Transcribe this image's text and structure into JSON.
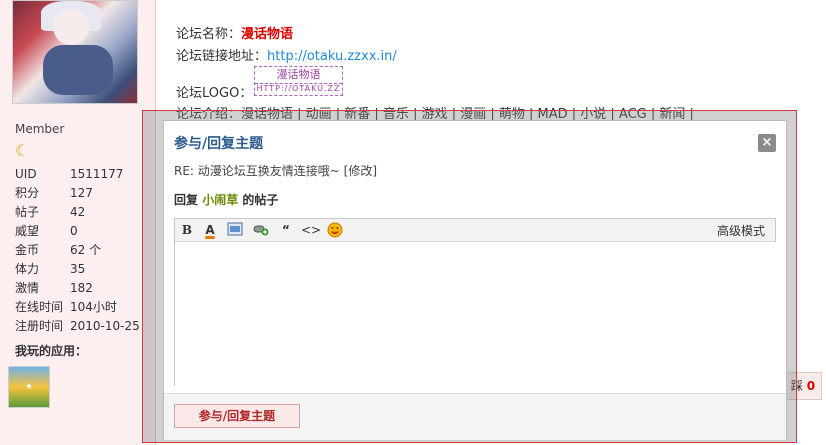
{
  "profile": {
    "group": "Member",
    "level_icon": "moon-icon",
    "stats": [
      {
        "key": "UID",
        "value": "1511177"
      },
      {
        "key": "积分",
        "value": "127"
      },
      {
        "key": "帖子",
        "value": "42"
      },
      {
        "key": "威望",
        "value": "0"
      },
      {
        "key": "金币",
        "value": "62 个"
      },
      {
        "key": "体力",
        "value": "35"
      },
      {
        "key": "激情",
        "value": "182"
      },
      {
        "key": "在线时间",
        "value": "104小时"
      },
      {
        "key": "注册时间",
        "value": "2010-10-25"
      }
    ],
    "apps_title": "我玩的应用："
  },
  "forum_info": {
    "name_label": "论坛名称：",
    "name_value": "漫话物语",
    "url_label": "论坛链接地址：",
    "url_value": "http://otaku.zzxx.in/",
    "logo_label": "论坛LOGO：",
    "logo_text": "漫话物语",
    "logo_subtext": "HTTP://OTAKU.ZZ",
    "intro": "论坛介绍：漫话物语 | 动画 | 新番 | 音乐 | 游戏 | 漫画 | 萌物 | MAD | 小说 | ACG | 新闻 |"
  },
  "bg_right": {
    "label": "踩",
    "count": "0"
  },
  "dialog": {
    "title": "参与/回复主题",
    "close_label": "×",
    "re_line": "RE: 动漫论坛互换友情连接哦~ [修改]",
    "reply_prefix": "回复 ",
    "reply_user": "小闹草",
    "reply_suffix": " 的帖子",
    "toolbar": {
      "bold": "B",
      "color": "A",
      "quote": "“",
      "code": "<>",
      "advanced": "高级模式"
    },
    "submit_label": "参与/回复主题"
  },
  "colors": {
    "accent": "#d00000",
    "title_blue": "#2b5a8c",
    "frame_red": "#d23c3c"
  }
}
